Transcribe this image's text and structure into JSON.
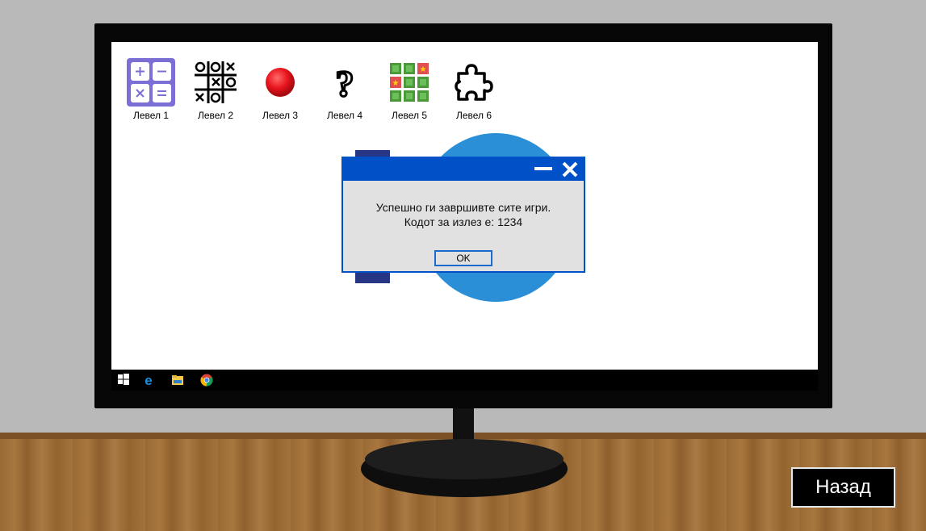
{
  "levels": [
    {
      "label": "Левел 1",
      "icon": "calculator-icon"
    },
    {
      "label": "Левел 2",
      "icon": "tic-tac-toe-icon"
    },
    {
      "label": "Левел 3",
      "icon": "red-ball-icon"
    },
    {
      "label": "Левел 4",
      "icon": "question-mark-icon"
    },
    {
      "label": "Левел 5",
      "icon": "grid-tiles-icon"
    },
    {
      "label": "Левел 6",
      "icon": "puzzle-piece-icon"
    }
  ],
  "dialog": {
    "line1": "Успешно ги завршивте сите игри.",
    "line2": "Кодот за излез е: 1234",
    "ok_label": "OK"
  },
  "taskbar": {
    "icons": [
      "windows-start-icon",
      "edge-browser-icon",
      "file-explorer-icon",
      "chrome-browser-icon"
    ]
  },
  "back_button": {
    "label": "Назад"
  },
  "colors": {
    "dialog_titlebar": "#0050c8",
    "dialog_body": "#e1e1e1",
    "circle_blue": "#2a8fd6",
    "rect_navy": "#263584"
  }
}
